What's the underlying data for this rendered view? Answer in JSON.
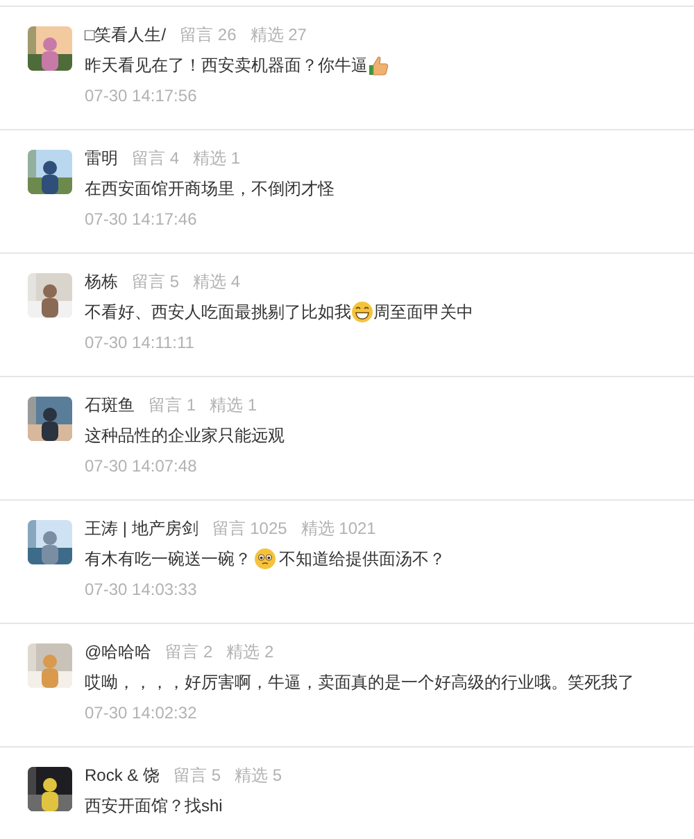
{
  "comments": [
    {
      "name": "□笑看人生/",
      "replies": "留言 26",
      "picks": "精选 27",
      "content": [
        {
          "kind": "text",
          "text": "昨天看见在了！西安卖机器面？你牛逼"
        },
        {
          "kind": "thumbsup"
        }
      ],
      "time": "07-30 14:17:56"
    },
    {
      "name": "雷明",
      "replies": "留言 4",
      "picks": "精选 1",
      "content": [
        {
          "kind": "text",
          "text": "在西安面馆开商场里，不倒闭才怪"
        }
      ],
      "time": "07-30 14:17:46"
    },
    {
      "name": "杨栋",
      "replies": "留言 5",
      "picks": "精选 4",
      "content": [
        {
          "kind": "text",
          "text": "不看好、西安人吃面最挑剔了比如我"
        },
        {
          "kind": "grin"
        },
        {
          "kind": "text",
          "text": "周至面甲关中"
        }
      ],
      "time": "07-30 14:11:11"
    },
    {
      "name": "石斑鱼",
      "replies": "留言 1",
      "picks": "精选 1",
      "content": [
        {
          "kind": "text",
          "text": "这种品性的企业家只能远观"
        }
      ],
      "time": "07-30 14:07:48"
    },
    {
      "name": "王涛 | 地产房剑",
      "replies": "留言 1025",
      "picks": "精选 1021",
      "content": [
        {
          "kind": "text",
          "text": "有木有吃一碗送一碗？"
        },
        {
          "kind": "pleading"
        },
        {
          "kind": "text",
          "text": "不知道给提供面汤不？"
        }
      ],
      "time": "07-30 14:03:33"
    },
    {
      "name": "@哈哈哈",
      "replies": "留言 2",
      "picks": "精选 2",
      "content": [
        {
          "kind": "text",
          "text": "哎呦，，，，好厉害啊，牛逼，卖面真的是一个好高级的行业哦。笑死我了"
        }
      ],
      "time": "07-30 14:02:32"
    },
    {
      "name": "Rock & 饶",
      "replies": "留言 5",
      "picks": "精选 5",
      "content": [
        {
          "kind": "text",
          "text": "西安开面馆？找shi"
        }
      ]
    }
  ]
}
